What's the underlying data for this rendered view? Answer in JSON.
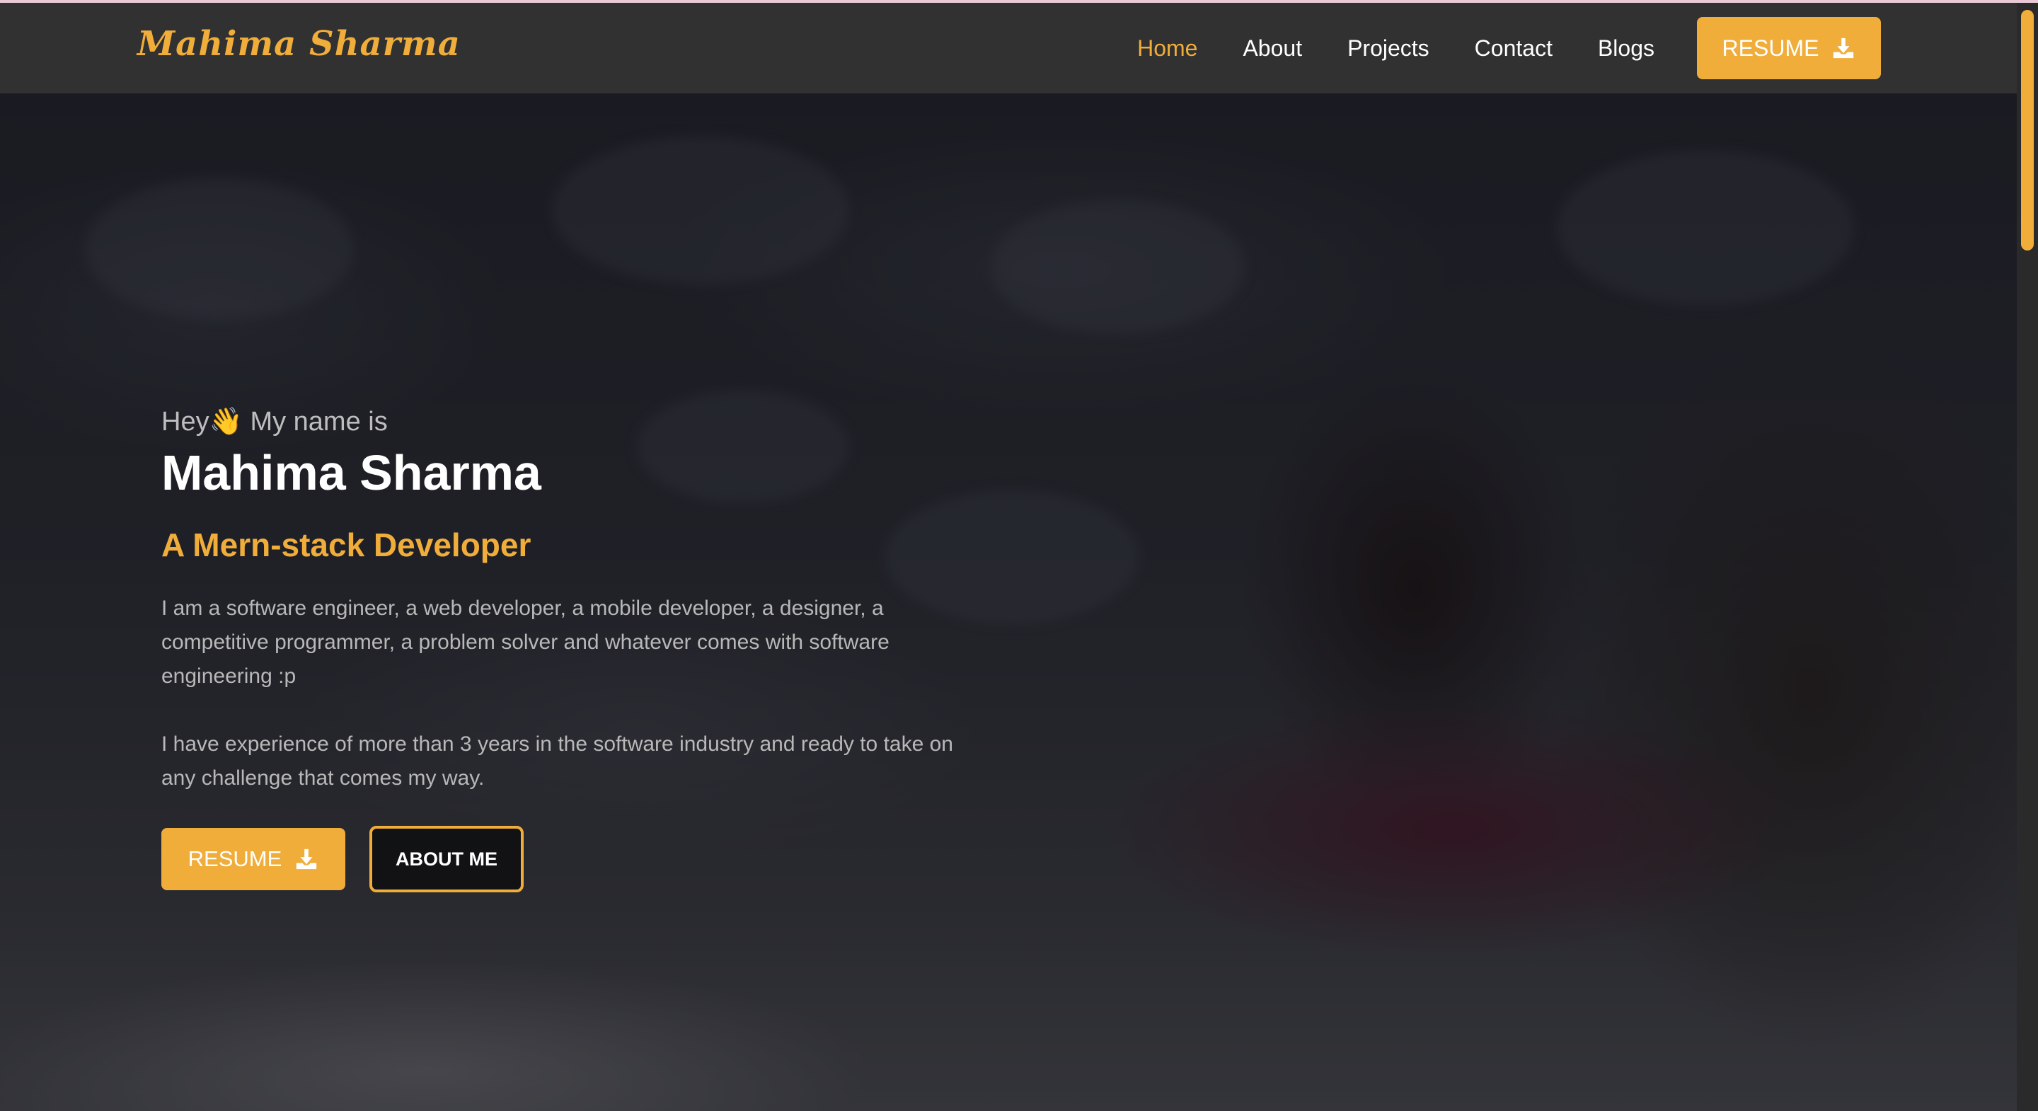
{
  "navbar": {
    "brand": "Mahima Sharma",
    "links": [
      {
        "label": "Home",
        "active": true
      },
      {
        "label": "About",
        "active": false
      },
      {
        "label": "Projects",
        "active": false
      },
      {
        "label": "Contact",
        "active": false
      },
      {
        "label": "Blogs",
        "active": false
      }
    ],
    "resume_label": "RESUME",
    "resume_icon": "download-icon"
  },
  "hero": {
    "greeting": "Hey👋 My name is",
    "name": "Mahima Sharma",
    "role": "A Mern-stack Developer",
    "description_1": "I am a software engineer, a web developer, a mobile developer, a designer, a competitive programmer, a problem solver and whatever comes with software engineering :p",
    "description_2": "I have experience of more than 3 years in the software industry and ready to take on any challenge that comes my way.",
    "resume_label": "RESUME",
    "about_label": "ABOUT ME"
  },
  "colors": {
    "accent": "#f0ad3a",
    "navbar_bg": "#313131"
  }
}
